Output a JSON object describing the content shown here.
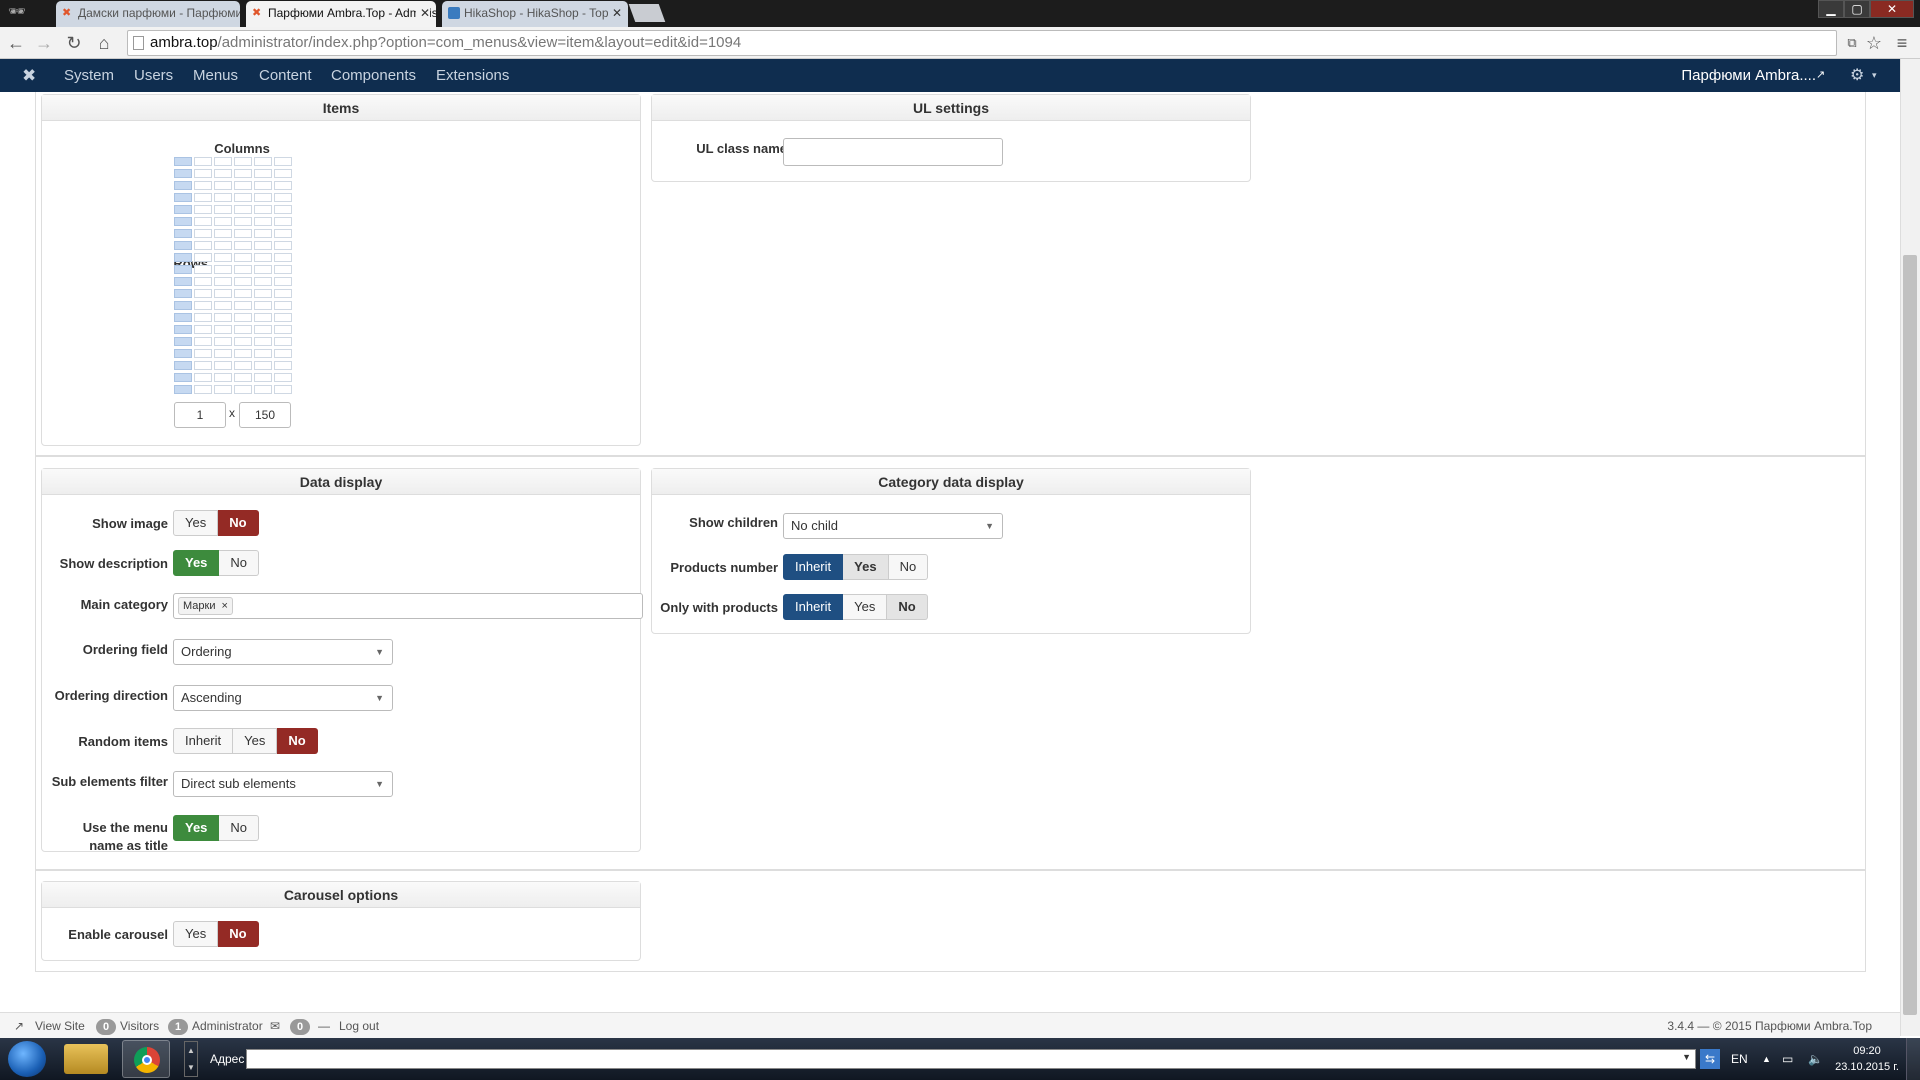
{
  "browser": {
    "tabs": [
      {
        "title": "Дамски парфюми - Парфюми Ambra.Top",
        "active": false
      },
      {
        "title": "Парфюми Ambra.Top - Administration",
        "active": true
      },
      {
        "title": "HikaShop - HikaShop - Top",
        "active": false
      }
    ],
    "url_host": "ambra.top",
    "url_path": "/administrator/index.php?option=com_menus&view=item&layout=edit&id=1094"
  },
  "admin_menu": {
    "items": [
      "System",
      "Users",
      "Menus",
      "Content",
      "Components",
      "Extensions"
    ],
    "site_name": "Парфюми Ambra...."
  },
  "items_panel": {
    "title": "Items",
    "columns_label": "Columns",
    "rows_label": "Rows",
    "columns_value": "1",
    "x_label": "x",
    "rows_value": "150",
    "grid_columns": 6,
    "grid_rows": 20,
    "selected_columns": 1
  },
  "ul_panel": {
    "title": "UL settings",
    "class_label": "UL class name",
    "class_value": ""
  },
  "data_display": {
    "title": "Data display",
    "show_image": {
      "label": "Show image",
      "yes": "Yes",
      "no": "No"
    },
    "show_description": {
      "label": "Show description",
      "yes": "Yes",
      "no": "No"
    },
    "main_category": {
      "label": "Main category",
      "tag": "Марки",
      "remove": "×"
    },
    "ordering_field": {
      "label": "Ordering field",
      "value": "Ordering"
    },
    "ordering_direction": {
      "label": "Ordering direction",
      "value": "Ascending"
    },
    "random_items": {
      "label": "Random items",
      "inherit": "Inherit",
      "yes": "Yes",
      "no": "No"
    },
    "sub_elements": {
      "label": "Sub elements filter",
      "value": "Direct sub elements"
    },
    "menu_title": {
      "label_line1": "Use the menu",
      "label_line2": "name as title",
      "yes": "Yes",
      "no": "No"
    }
  },
  "category_display": {
    "title": "Category data display",
    "show_children": {
      "label": "Show children",
      "value": "No child"
    },
    "products_number": {
      "label": "Products number",
      "inherit": "Inherit",
      "yes": "Yes",
      "no": "No"
    },
    "only_with_products": {
      "label": "Only with products",
      "inherit": "Inherit",
      "yes": "Yes",
      "no": "No"
    }
  },
  "carousel": {
    "title": "Carousel options",
    "enable": {
      "label": "Enable carousel",
      "yes": "Yes",
      "no": "No"
    }
  },
  "status_bar": {
    "view_site": "View Site",
    "visitors_count": "0",
    "visitors": "Visitors",
    "admin_count": "1",
    "administrator": "Administrator",
    "messages_count": "0",
    "logout": "Log out",
    "copyright": "3.4.4 — © 2015 Парфюми Ambra.Top"
  },
  "taskbar": {
    "address_label": "Адрес",
    "lang": "EN",
    "time": "09:20",
    "date": "23.10.2015 г."
  },
  "colors": {
    "header": "#0f2d4f",
    "no_active": "#942a25",
    "yes_active": "#3d8b3d",
    "inherit_active": "#1f4f82"
  }
}
